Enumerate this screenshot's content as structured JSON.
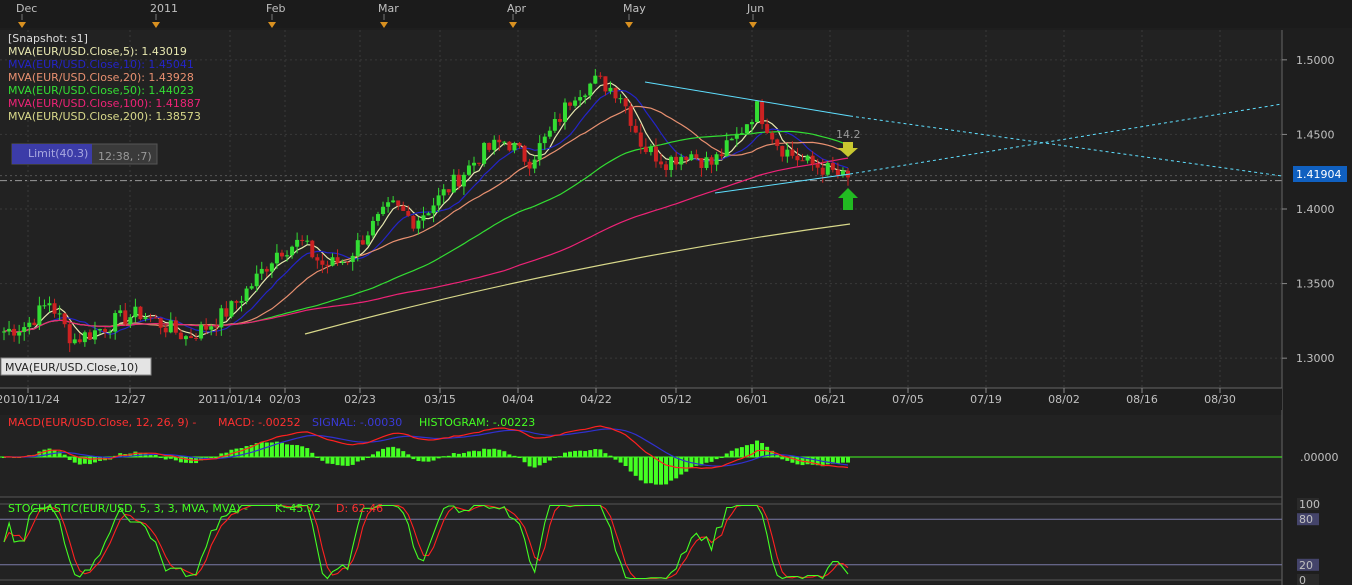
{
  "colors": {
    "background": "#1e1e1e",
    "panel": "#222222",
    "grid": "#3a3a3a",
    "axis_text": "#c0c0c0",
    "bull": "#33dd33",
    "bear": "#cc2222",
    "ma5": "#e8e8b0",
    "ma10": "#2424c8",
    "ma20": "#e89070",
    "ma50": "#33dd33",
    "ma100": "#ee2277",
    "ma200": "#d8d88a",
    "trendline": "#5fdfff",
    "macd": "#ff2020",
    "signal": "#3030d0",
    "histogram": "#44ff22",
    "stoch_k": "#44ff22",
    "stoch_d": "#ff2020",
    "price_badge": "#1060c0",
    "arrow_up": "#22bb22",
    "arrow_down": "#c8c830",
    "event_marker": "#d89020"
  },
  "top_axis": {
    "labels": [
      "Dec",
      "2011",
      "Feb",
      "Mar",
      "Apr",
      "May",
      "Jun"
    ]
  },
  "price_panel": {
    "snapshot_label": "[Snapshot: s1]",
    "legend": [
      {
        "text": "MVA(EUR/USD.Close,5): 1.43019",
        "color": "#e8e8b0"
      },
      {
        "text": "MVA(EUR/USD.Close,10): 1.45041",
        "color": "#2424c8"
      },
      {
        "text": "MVA(EUR/USD.Close,20): 1.43928",
        "color": "#e89070"
      },
      {
        "text": "MVA(EUR/USD.Close,50): 1.44023",
        "color": "#33dd33"
      },
      {
        "text": "MVA(EUR/USD.Close,100): 1.41887",
        "color": "#ee2277"
      },
      {
        "text": "MVA(EUR/USD.Close,200): 1.38573",
        "color": "#d8d88a"
      }
    ],
    "limit_label": "Limit(40.3)",
    "limit_time": "12:38, :7)",
    "tooltip": "MVA(EUR/USD.Close,10)",
    "current_price": "1.41904",
    "annotation_value": "14.2",
    "y_ticks": [
      "1.5000",
      "1.4500",
      "1.4000",
      "1.3500",
      "1.3000"
    ]
  },
  "x_axis": {
    "labels": [
      "2010/11/24",
      "12/27",
      "2011/01/14",
      "02/03",
      "02/23",
      "03/15",
      "04/04",
      "04/22",
      "05/12",
      "06/01",
      "06/21",
      "07/05",
      "07/19",
      "08/02",
      "08/16",
      "08/30"
    ]
  },
  "macd_panel": {
    "title": "MACD(EUR/USD.Close, 12, 26, 9) -",
    "macd_label": "MACD: -.00252",
    "signal_label": "SIGNAL: -.00030",
    "histogram_label": "HISTOGRAM: -.00223",
    "zero_tick": ".00000"
  },
  "stoch_panel": {
    "title": "STOCHASTIC(EUR/USD, 5, 3, 3, MVA, MVA) -",
    "k_label": "K: 45.72",
    "d_label": "D: 62.46",
    "y_ticks": [
      "100",
      "80",
      "20",
      "0"
    ]
  },
  "chart_data": {
    "type": "candlestick",
    "title": "EUR/USD",
    "x_dates": [
      "2010/11/24",
      "12/27",
      "2011/01/14",
      "02/03",
      "02/23",
      "03/15",
      "04/04",
      "04/22",
      "05/12",
      "06/01",
      "06/21"
    ],
    "price_path": [
      1.318,
      1.322,
      1.338,
      1.312,
      1.318,
      1.326,
      1.33,
      1.322,
      1.314,
      1.322,
      1.334,
      1.352,
      1.372,
      1.378,
      1.362,
      1.366,
      1.386,
      1.402,
      1.392,
      1.406,
      1.422,
      1.438,
      1.446,
      1.432,
      1.452,
      1.478,
      1.486,
      1.478,
      1.442,
      1.432,
      1.438,
      1.43,
      1.446,
      1.468,
      1.442,
      1.432,
      1.427,
      1.419
    ],
    "price_range": [
      1.28,
      1.52
    ],
    "moving_averages": [
      {
        "name": "MVA(EUR/USD.Close,5)",
        "last": 1.43019
      },
      {
        "name": "MVA(EUR/USD.Close,10)",
        "last": 1.45041
      },
      {
        "name": "MVA(EUR/USD.Close,20)",
        "last": 1.43928
      },
      {
        "name": "MVA(EUR/USD.Close,50)",
        "last": 1.44023
      },
      {
        "name": "MVA(EUR/USD.Close,100)",
        "last": 1.41887
      },
      {
        "name": "MVA(EUR/USD.Close,200)",
        "last": 1.38573
      }
    ],
    "last_price": 1.41904,
    "macd": {
      "macd": -0.00252,
      "signal": -0.0003,
      "histogram": -0.00223
    },
    "stochastic": {
      "k": 45.72,
      "d": 62.46,
      "levels": [
        100,
        80,
        20,
        0
      ]
    },
    "grid": true,
    "legend_position": "top-left"
  }
}
